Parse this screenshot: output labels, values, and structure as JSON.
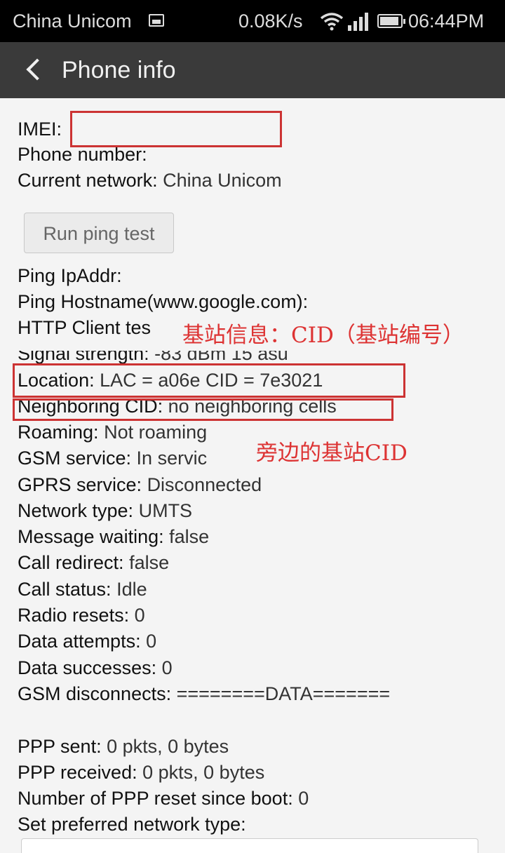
{
  "status_bar": {
    "carrier": "China Unicom",
    "speed": "0.08K/s",
    "time": "06:44PM",
    "icons": [
      "photo-icon",
      "wifi-icon",
      "signal-icon",
      "battery-icon"
    ]
  },
  "toolbar": {
    "title": "Phone info"
  },
  "info": {
    "imei_label": "IMEI:",
    "phone_number_label": "Phone number:",
    "current_network_label": "Current network:",
    "current_network_value": "China Unicom",
    "run_ping_label": "Run ping test",
    "ping_ipaddr_label": "Ping IpAddr:",
    "ping_hostname_label": "Ping Hostname(www.google.com):",
    "http_client_label": "HTTP Client tes",
    "signal_strength_label": "Signal strength:",
    "signal_strength_value": "-83 dBm   15 asu",
    "location_label": "Location:",
    "location_value": "LAC = a06e   CID = 7e3021",
    "neighboring_label": "Neighboring CID:",
    "neighboring_value": "no neighboring cells",
    "roaming_label": "Roaming:",
    "roaming_value": "Not roaming",
    "gsm_service_label": "GSM service:",
    "gsm_service_value": "In servic",
    "gprs_service_label": "GPRS service:",
    "gprs_service_value": "Disconnected",
    "network_type_label": "Network type:",
    "network_type_value": "UMTS",
    "message_waiting_label": "Message waiting:",
    "message_waiting_value": "false",
    "call_redirect_label": "Call redirect:",
    "call_redirect_value": "false",
    "call_status_label": "Call status:",
    "call_status_value": "Idle",
    "radio_resets_label": "Radio resets:",
    "radio_resets_value": "0",
    "data_attempts_label": "Data attempts:",
    "data_attempts_value": "0",
    "data_successes_label": "Data successes:",
    "data_successes_value": "0",
    "gsm_disconnects_label": "GSM disconnects:",
    "gsm_disconnects_value": "========DATA=======",
    "ppp_sent_label": "PPP sent:",
    "ppp_sent_value": "0 pkts, 0 bytes",
    "ppp_received_label": "PPP received:",
    "ppp_received_value": "0 pkts, 0 bytes",
    "ppp_reset_label": "Number of PPP reset since boot:",
    "ppp_reset_value": "0",
    "preferred_network_label": "Set preferred network type:"
  },
  "annotations": {
    "cid_note": "基站信息：CID（基站编号）",
    "neighbor_note": "旁边的基站CID"
  },
  "colors": {
    "annotation_red": "#cc3333",
    "toolbar_bg": "#3a3a3a",
    "status_bg": "#000000"
  }
}
